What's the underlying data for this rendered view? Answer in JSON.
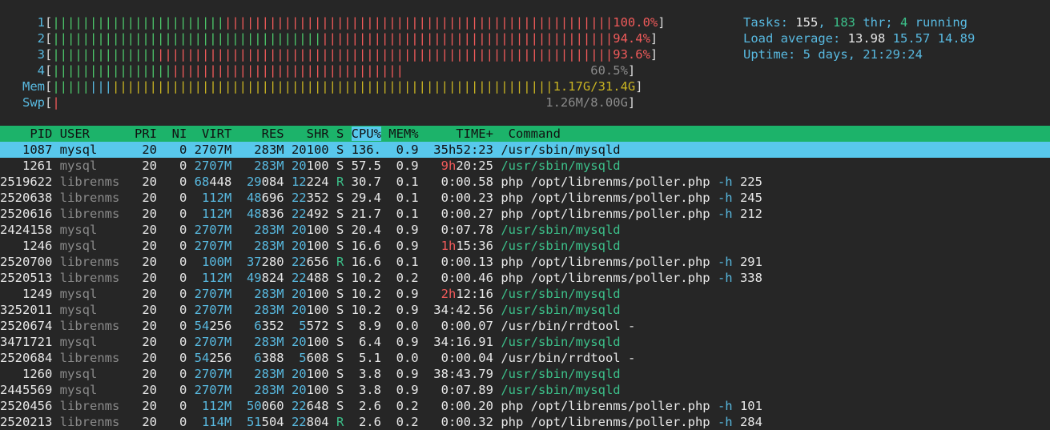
{
  "meters": [
    {
      "label": "1",
      "bars": [
        {
          "n": 23,
          "c": "green"
        },
        {
          "n": 52,
          "c": "red"
        }
      ],
      "value": "100.0%",
      "value_color": "red"
    },
    {
      "label": "2",
      "bars": [
        {
          "n": 36,
          "c": "green"
        },
        {
          "n": 39,
          "c": "red"
        }
      ],
      "value": "94.4%",
      "value_color": "red"
    },
    {
      "label": "3",
      "bars": [
        {
          "n": 14,
          "c": "green"
        },
        {
          "n": 61,
          "c": "red"
        }
      ],
      "value": "93.6%",
      "value_color": "red"
    },
    {
      "label": "4",
      "bars": [
        {
          "n": 16,
          "c": "green"
        },
        {
          "n": 31,
          "c": "red"
        }
      ],
      "value": "60.5%",
      "value_color": "grey"
    },
    {
      "label": "Mem",
      "bars": [
        {
          "n": 5,
          "c": "green"
        },
        {
          "n": 3,
          "c": "blue"
        },
        {
          "n": 59,
          "c": "yellow"
        }
      ],
      "value": "1.17G/31.4G",
      "value_color": "yellow"
    },
    {
      "label": "Swp",
      "bars": [
        {
          "n": 1,
          "c": "red"
        }
      ],
      "value": "1.26M/8.00G",
      "value_color": "grey"
    }
  ],
  "summary": {
    "tasks_label": "Tasks: ",
    "tasks": "155",
    "thr": "183",
    "thr_label": " thr; ",
    "running": "4",
    "running_label": " running",
    "load_label": "Load average: ",
    "load1": "13.98",
    "load5": "15.57",
    "load15": "14.89",
    "uptime_label": "Uptime: ",
    "uptime": "5 days, 21:29:24"
  },
  "columns": [
    "PID",
    "USER",
    "PRI",
    "NI",
    "VIRT",
    "RES",
    "SHR",
    "S",
    "CPU%",
    "MEM%",
    "TIME+",
    "Command"
  ],
  "processes": [
    {
      "pid": "1087",
      "user": "mysql",
      "pri": "20",
      "ni": "0",
      "virt": "2707M",
      "res": "283M",
      "shr": "20100",
      "s": "S",
      "cpu": "136.",
      "mem": "0.9",
      "time": "35h52:23",
      "cmd": "/usr/sbin/mysqld",
      "args": ""
    },
    {
      "pid": "1261",
      "user": "mysql",
      "pri": "20",
      "ni": "0",
      "virt": "2707M",
      "res": "283M",
      "shr": "20100",
      "s": "S",
      "cpu": "57.5",
      "mem": "0.9",
      "time": "9h20:25",
      "cmd": "/usr/sbin/mysqld",
      "args": ""
    },
    {
      "pid": "2519622",
      "user": "librenms",
      "pri": "20",
      "ni": "0",
      "virt": "68448",
      "res": "29084",
      "shr": "12224",
      "s": "R",
      "cpu": "30.7",
      "mem": "0.1",
      "time": "0:00.58",
      "cmd": "php /opt/librenms/poller.php",
      "args": "-h 225"
    },
    {
      "pid": "2520638",
      "user": "librenms",
      "pri": "20",
      "ni": "0",
      "virt": "112M",
      "res": "48696",
      "shr": "22352",
      "s": "S",
      "cpu": "29.4",
      "mem": "0.1",
      "time": "0:00.23",
      "cmd": "php /opt/librenms/poller.php",
      "args": "-h 245"
    },
    {
      "pid": "2520616",
      "user": "librenms",
      "pri": "20",
      "ni": "0",
      "virt": "112M",
      "res": "48836",
      "shr": "22492",
      "s": "S",
      "cpu": "21.7",
      "mem": "0.1",
      "time": "0:00.27",
      "cmd": "php /opt/librenms/poller.php",
      "args": "-h 212"
    },
    {
      "pid": "2424158",
      "user": "mysql",
      "pri": "20",
      "ni": "0",
      "virt": "2707M",
      "res": "283M",
      "shr": "20100",
      "s": "S",
      "cpu": "20.4",
      "mem": "0.9",
      "time": "0:07.78",
      "cmd": "/usr/sbin/mysqld",
      "args": ""
    },
    {
      "pid": "1246",
      "user": "mysql",
      "pri": "20",
      "ni": "0",
      "virt": "2707M",
      "res": "283M",
      "shr": "20100",
      "s": "S",
      "cpu": "16.6",
      "mem": "0.9",
      "time": "1h15:36",
      "cmd": "/usr/sbin/mysqld",
      "args": ""
    },
    {
      "pid": "2520700",
      "user": "librenms",
      "pri": "20",
      "ni": "0",
      "virt": "100M",
      "res": "37280",
      "shr": "22656",
      "s": "R",
      "cpu": "16.6",
      "mem": "0.1",
      "time": "0:00.13",
      "cmd": "php /opt/librenms/poller.php",
      "args": "-h 291"
    },
    {
      "pid": "2520513",
      "user": "librenms",
      "pri": "20",
      "ni": "0",
      "virt": "112M",
      "res": "49824",
      "shr": "22488",
      "s": "S",
      "cpu": "10.2",
      "mem": "0.2",
      "time": "0:00.46",
      "cmd": "php /opt/librenms/poller.php",
      "args": "-h 338"
    },
    {
      "pid": "1249",
      "user": "mysql",
      "pri": "20",
      "ni": "0",
      "virt": "2707M",
      "res": "283M",
      "shr": "20100",
      "s": "S",
      "cpu": "10.2",
      "mem": "0.9",
      "time": "2h12:16",
      "cmd": "/usr/sbin/mysqld",
      "args": ""
    },
    {
      "pid": "3252011",
      "user": "mysql",
      "pri": "20",
      "ni": "0",
      "virt": "2707M",
      "res": "283M",
      "shr": "20100",
      "s": "S",
      "cpu": "10.2",
      "mem": "0.9",
      "time": "34:42.56",
      "cmd": "/usr/sbin/mysqld",
      "args": ""
    },
    {
      "pid": "2520674",
      "user": "librenms",
      "pri": "20",
      "ni": "0",
      "virt": "54256",
      "res": "6352",
      "shr": "5572",
      "s": "S",
      "cpu": "8.9",
      "mem": "0.0",
      "time": "0:00.07",
      "cmd": "/usr/bin/rrdtool -",
      "args": ""
    },
    {
      "pid": "3471721",
      "user": "mysql",
      "pri": "20",
      "ni": "0",
      "virt": "2707M",
      "res": "283M",
      "shr": "20100",
      "s": "S",
      "cpu": "6.4",
      "mem": "0.9",
      "time": "34:16.91",
      "cmd": "/usr/sbin/mysqld",
      "args": ""
    },
    {
      "pid": "2520684",
      "user": "librenms",
      "pri": "20",
      "ni": "0",
      "virt": "54256",
      "res": "6388",
      "shr": "5608",
      "s": "S",
      "cpu": "5.1",
      "mem": "0.0",
      "time": "0:00.04",
      "cmd": "/usr/bin/rrdtool -",
      "args": ""
    },
    {
      "pid": "1260",
      "user": "mysql",
      "pri": "20",
      "ni": "0",
      "virt": "2707M",
      "res": "283M",
      "shr": "20100",
      "s": "S",
      "cpu": "3.8",
      "mem": "0.9",
      "time": "38:43.79",
      "cmd": "/usr/sbin/mysqld",
      "args": ""
    },
    {
      "pid": "2445569",
      "user": "mysql",
      "pri": "20",
      "ni": "0",
      "virt": "2707M",
      "res": "283M",
      "shr": "20100",
      "s": "S",
      "cpu": "3.8",
      "mem": "0.9",
      "time": "0:07.89",
      "cmd": "/usr/sbin/mysqld",
      "args": ""
    },
    {
      "pid": "2520456",
      "user": "librenms",
      "pri": "20",
      "ni": "0",
      "virt": "112M",
      "res": "50060",
      "shr": "22648",
      "s": "S",
      "cpu": "2.6",
      "mem": "0.2",
      "time": "0:00.20",
      "cmd": "php /opt/librenms/poller.php",
      "args": "-h 101"
    },
    {
      "pid": "2520213",
      "user": "librenms",
      "pri": "20",
      "ni": "0",
      "virt": "114M",
      "res": "51504",
      "shr": "22804",
      "s": "R",
      "cpu": "2.6",
      "mem": "0.2",
      "time": "0:00.32",
      "cmd": "php /opt/librenms/poller.php",
      "args": "-h 284"
    }
  ]
}
